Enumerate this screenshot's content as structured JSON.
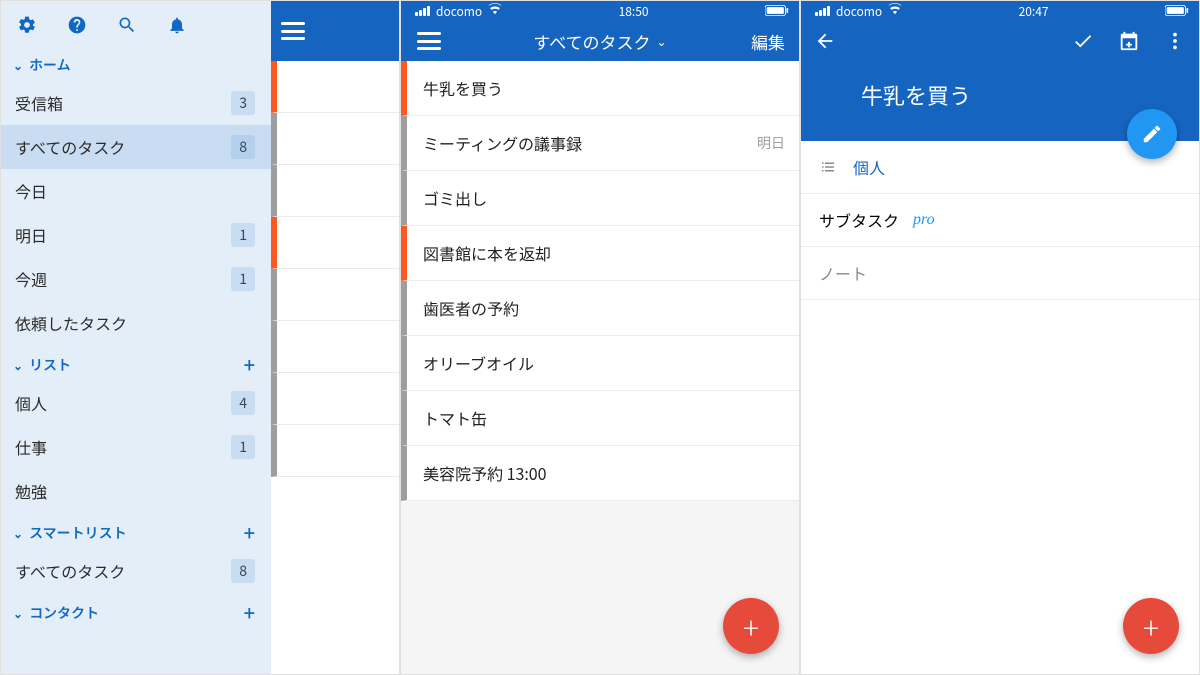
{
  "sidebar": {
    "sections": {
      "home": {
        "title": "ホーム"
      },
      "lists": {
        "title": "リスト"
      },
      "smart": {
        "title": "スマートリスト"
      },
      "contacts": {
        "title": "コンタクト"
      }
    },
    "home_items": [
      {
        "label": "受信箱",
        "count": "3"
      },
      {
        "label": "すべてのタスク",
        "count": "8",
        "selected": true
      },
      {
        "label": "今日",
        "count": ""
      },
      {
        "label": "明日",
        "count": "1"
      },
      {
        "label": "今週",
        "count": "1"
      },
      {
        "label": "依頼したタスク",
        "count": ""
      }
    ],
    "list_items": [
      {
        "label": "個人",
        "count": "4"
      },
      {
        "label": "仕事",
        "count": "1"
      },
      {
        "label": "勉強",
        "count": ""
      }
    ],
    "smart_items": [
      {
        "label": "すべてのタスク",
        "count": "8"
      }
    ]
  },
  "panel2": {
    "status": {
      "carrier": "docomo",
      "time": "18:50"
    },
    "title": "すべてのタスク",
    "edit": "編集",
    "tasks": [
      {
        "label": "牛乳を買う",
        "due": "",
        "color": "orange"
      },
      {
        "label": "ミーティングの議事録",
        "due": "明日",
        "color": "grey"
      },
      {
        "label": "ゴミ出し",
        "due": "",
        "color": "grey"
      },
      {
        "label": "図書館に本を返却",
        "due": "",
        "color": "orange"
      },
      {
        "label": "歯医者の予約",
        "due": "",
        "color": "grey"
      },
      {
        "label": "オリーブオイル",
        "due": "",
        "color": "grey"
      },
      {
        "label": "トマト缶",
        "due": "",
        "color": "grey"
      },
      {
        "label": "美容院予約 13:00",
        "due": "",
        "color": "grey"
      }
    ]
  },
  "panel3": {
    "status": {
      "carrier": "docomo",
      "time": "20:47"
    },
    "title": "牛乳を買う",
    "list_link": "個人",
    "subtask_label": "サブタスク",
    "pro_badge": "pro",
    "notes_label": "ノート"
  }
}
